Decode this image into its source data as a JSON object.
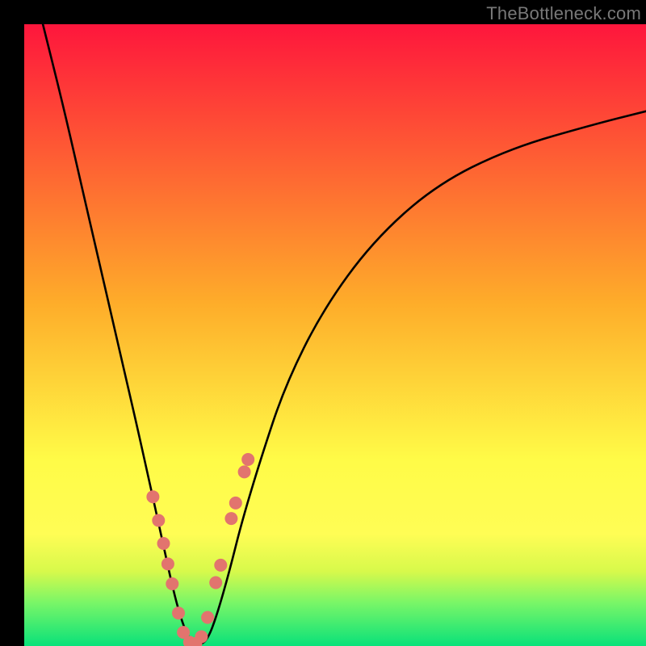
{
  "watermark": "TheBottleneck.com",
  "colors": {
    "red_top": "#fe163c",
    "orange_mid": "#fead2a",
    "yellow": "#fffb47",
    "yellow_green": "#d7f94b",
    "green_band": "#7af667",
    "green_bottom": "#09e17a",
    "curve": "#000000",
    "marker_fill": "#e2746e",
    "marker_stroke": "#be5851",
    "frame_bg": "#000000"
  },
  "chart_data": {
    "type": "line",
    "title": "",
    "xlabel": "",
    "ylabel": "",
    "xlim": [
      0,
      100
    ],
    "ylim": [
      0,
      100
    ],
    "note": "Axes are unlabeled in the source image; values are percentages estimated from pixel positions.",
    "series": [
      {
        "name": "bottleneck-curve",
        "x": [
          3,
          6,
          9,
          12,
          15,
          18,
          20,
          22,
          23.5,
          25,
          26.5,
          28,
          29.5,
          31,
          33,
          35,
          38,
          42,
          48,
          56,
          66,
          78,
          92,
          100
        ],
        "y": [
          100,
          88,
          75,
          62,
          49,
          36,
          27,
          18,
          11,
          5,
          1,
          0,
          1,
          5,
          12,
          20,
          30,
          42,
          54,
          65,
          74,
          80,
          84,
          86
        ]
      }
    ],
    "markers": {
      "name": "highlighted-points",
      "x": [
        20.7,
        21.6,
        22.4,
        23.1,
        23.8,
        24.8,
        25.6,
        26.6,
        27.6,
        28.5,
        29.5,
        30.8,
        31.6,
        33.3,
        34.0,
        35.4,
        36.0
      ],
      "y": [
        24.0,
        20.2,
        16.5,
        13.2,
        10.0,
        5.3,
        2.2,
        0.6,
        0.4,
        1.5,
        4.6,
        10.2,
        13.0,
        20.5,
        23.0,
        28.0,
        30.0
      ]
    },
    "gradient_stops": [
      {
        "pct": 0,
        "color": "#fe163c"
      },
      {
        "pct": 45,
        "color": "#fead2a"
      },
      {
        "pct": 70,
        "color": "#fffb47"
      },
      {
        "pct": 82,
        "color": "#fffd55"
      },
      {
        "pct": 88,
        "color": "#d7f94b"
      },
      {
        "pct": 93,
        "color": "#7af667"
      },
      {
        "pct": 100,
        "color": "#09e17a"
      }
    ]
  }
}
